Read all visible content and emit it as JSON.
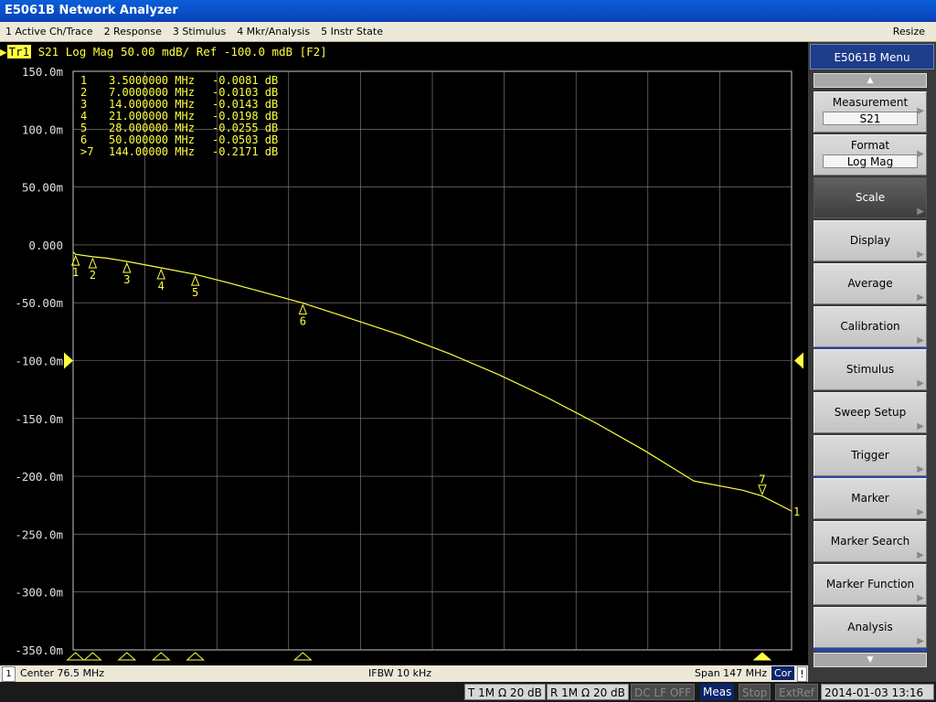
{
  "window": {
    "title": "E5061B Network Analyzer"
  },
  "menu": [
    "1 Active Ch/Trace",
    "2 Response",
    "3 Stimulus",
    "4 Mkr/Analysis",
    "5 Instr State"
  ],
  "menu_resize": "Resize",
  "trace": {
    "badge": "Tr1",
    "header": " S21 Log Mag 50.00 mdB/ Ref -100.0 mdB [F2]"
  },
  "y_ticks": [
    "150.0m",
    "100.0m",
    "50.00m",
    "0.000",
    "-50.00m",
    "-100.0m",
    "-150.0m",
    "-200.0m",
    "-250.0m",
    "-300.0m",
    "-350.0m"
  ],
  "markers": [
    {
      "id": "1",
      "label": "1",
      "freq": "3.5000000 MHz",
      "value": "-0.0081 dB",
      "f_mhz": 3.5,
      "db": -0.0081
    },
    {
      "id": "2",
      "label": "2",
      "freq": "7.0000000 MHz",
      "value": "-0.0103 dB",
      "f_mhz": 7.0,
      "db": -0.0103
    },
    {
      "id": "3",
      "label": "3",
      "freq": "14.000000 MHz",
      "value": "-0.0143 dB",
      "f_mhz": 14.0,
      "db": -0.0143
    },
    {
      "id": "4",
      "label": "4",
      "freq": "21.000000 MHz",
      "value": "-0.0198 dB",
      "f_mhz": 21.0,
      "db": -0.0198
    },
    {
      "id": "5",
      "label": "5",
      "freq": "28.000000 MHz",
      "value": "-0.0255 dB",
      "f_mhz": 28.0,
      "db": -0.0255
    },
    {
      "id": "6",
      "label": "6",
      "freq": "50.000000 MHz",
      "value": "-0.0503 dB",
      "f_mhz": 50.0,
      "db": -0.0503
    },
    {
      "id": ">7",
      "label": "7",
      "freq": "144.00000 MHz",
      "value": "-0.2171 dB",
      "f_mhz": 144.0,
      "db": -0.2171
    }
  ],
  "ref_marker_label": "1",
  "status": {
    "ch": "1",
    "center": "Center  76.5 MHz",
    "ifbw": "IFBW 10 kHz",
    "span": "Span 147 MHz",
    "cor": "Cor",
    "excl": "!"
  },
  "bottom": {
    "t": "T 1M Ω 20 dB",
    "r": "R 1M Ω 20 dB",
    "dclf": "DC LF OFF",
    "meas": "Meas",
    "stop": "Stop",
    "extref": "ExtRef",
    "datetime": "2014-01-03 13:16"
  },
  "side_menu": {
    "title": "E5061B Menu",
    "up": "▲",
    "down": "▼",
    "items": [
      {
        "label": "Measurement",
        "value": "S21"
      },
      {
        "label": "Format",
        "value": "Log Mag"
      },
      {
        "label": "Scale",
        "selected": true
      },
      {
        "label": "Display"
      },
      {
        "label": "Average"
      },
      {
        "label": "Calibration"
      },
      {
        "label": "Stimulus"
      },
      {
        "label": "Sweep Setup"
      },
      {
        "label": "Trigger"
      },
      {
        "label": "Marker"
      },
      {
        "label": "Marker Search"
      },
      {
        "label": "Marker Function"
      },
      {
        "label": "Analysis"
      }
    ]
  },
  "chart_data": {
    "type": "line",
    "series": [
      {
        "x": [
          3,
          3.5,
          7,
          10,
          14,
          21,
          28,
          35,
          42,
          50,
          60,
          70,
          80,
          90,
          100,
          110,
          120,
          130,
          140,
          144,
          150
        ],
        "values": [
          -0.006,
          -0.0081,
          -0.0103,
          -0.0115,
          -0.0143,
          -0.0198,
          -0.0255,
          -0.033,
          -0.041,
          -0.0503,
          -0.064,
          -0.078,
          -0.094,
          -0.112,
          -0.132,
          -0.154,
          -0.178,
          -0.204,
          -0.212,
          -0.2171,
          -0.23
        ]
      }
    ],
    "ylim": [
      -0.35,
      0.15
    ],
    "xlim": [
      3,
      150
    ],
    "ref_level": -0.1,
    "grid": true,
    "color": "#ffff40"
  }
}
